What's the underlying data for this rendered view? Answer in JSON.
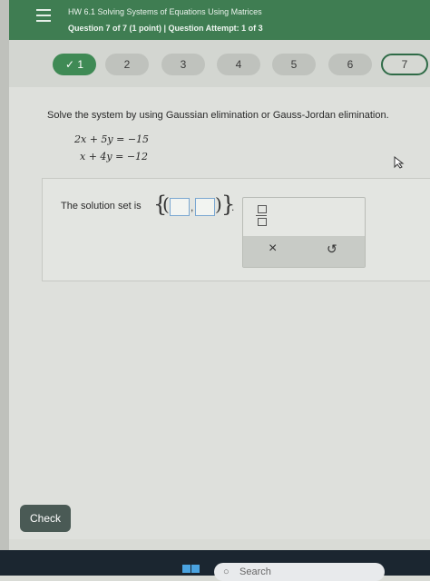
{
  "header": {
    "hw_title": "HW 6.1 Solving Systems of Equations Using Matrices",
    "question_line": "Question 7 of 7 (1 point)  |  Question Attempt: 1 of 3"
  },
  "nav": {
    "items": [
      {
        "label": "✓ 1"
      },
      {
        "label": "2"
      },
      {
        "label": "3"
      },
      {
        "label": "4"
      },
      {
        "label": "5"
      },
      {
        "label": "6"
      },
      {
        "label": "7"
      }
    ],
    "completed_color": "#3f8a55",
    "current_border": "#2f6b47"
  },
  "problem": {
    "instructions": "Solve the system by using Gaussian elimination or Gauss-Jordan elimination.",
    "equations": [
      "2x + 5y  =  −15",
      "x + 4y  =  −12"
    ]
  },
  "answer": {
    "prefix": "The solution set is",
    "open_brace": "{",
    "close_brace": "}",
    "open_paren": "(",
    "close_paren": ")",
    "comma": ",",
    "period": "."
  },
  "toolbox": {
    "clear_symbol": "×",
    "undo_symbol": "↺"
  },
  "footer": {
    "check_label": "Check",
    "search_label": "Search"
  },
  "icons": [
    "menu-icon",
    "cursor-icon",
    "fraction-icon",
    "windows-icon",
    "search-icon"
  ]
}
